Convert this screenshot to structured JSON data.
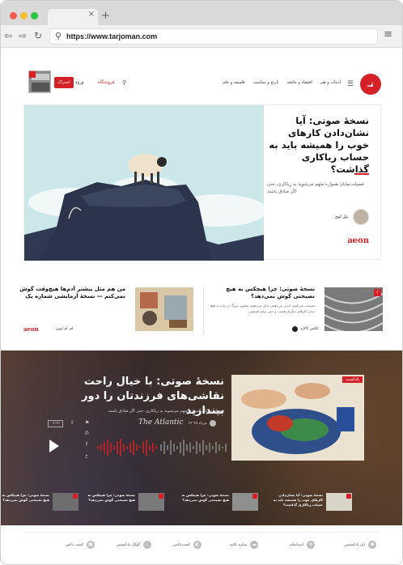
{
  "browser": {
    "url": "https://www.tarjoman.com",
    "tab_close": "×",
    "tab_plus": "+",
    "icons": [
      "back-icon",
      "forward-icon",
      "reload-icon",
      "search-icon",
      "menu-icon"
    ]
  },
  "header": {
    "logo_text": "تـ",
    "nav": [
      "ادبیات و هنر",
      "اقتصاد و جامعه",
      "تاریخ و سیاست",
      "فلسفه و علم"
    ],
    "shop": "فروشگاه",
    "login": "ورود",
    "subscribe": "اشتراک"
  },
  "hero": {
    "title": "نسخۀ صوتی: آیا نشان‌دادن کارهای خوب را همیشه باید به حساب ریاکاری گذاشت؟",
    "description": "فضیلت‌نمایان همواره متهم می‌شوند به ریاکاری، حتی اگر صادق باشند",
    "author": "نیل لوی",
    "brand": "aeon"
  },
  "cards": [
    {
      "title": "نسخۀ صوتی: چرا هیچکس به هیچ نصیحتی گوش نمی‌دهد؟",
      "description": "نصیحت می‌کنیم، اندرز می‌دهیم، تذکر می‌دهیم، تفاوتی بزرگ در باره به هیچ دیدن کارهای دیگران هست و حتی برای قسمتی",
      "author": "الکس کالارد"
    },
    {
      "title": "من هم مثل بیشتر آدم‌ها هیچ‌وقت گوش نمی‌کنم — نسخۀ آزمایشی شماره یک",
      "author": "ام. ام اوون",
      "brand": "aeon"
    }
  ],
  "podcast": {
    "badge": "پادکست",
    "title": "نسخۀ صوتی: با خیال راحت نقاشی‌های فرزندتان را دور بیندازید",
    "description": "فضیلت‌نمایان همواره متهم می‌شوند به ریاکاری، حتی اگر صادق باشند",
    "brand": "The Atlantic",
    "date": "۲۳ مرداد ۹۹",
    "time": "۰۴:۳۶",
    "share_icons": [
      "share-icon",
      "bookmark-icon"
    ],
    "social": [
      "instagram-icon",
      "facebook-icon",
      "twitter-icon"
    ],
    "mini": [
      "نسخۀ صوتی: چرا هیچکس به هیچ نصیحتی گوش نمی‌دهد؟",
      "نسخۀ صوتی: چرا هیچکس به هیچ نصیحتی گوش نمی‌دهد؟",
      "نسخۀ صوتی: چرا هیچکس به هیچ نصیحتی گوش نمی‌دهد؟",
      "نسخۀ صوتی: آیا نشان‌دادن کارهای خوب را همیشه باید به حساب ریاکاری گذاشت؟"
    ]
  },
  "platforms": [
    "اپل پادکستس",
    "اسپاتیفای",
    "ساوند کلاود",
    "کست‌باکس",
    "گوگل پادکستس",
    "کست باکس"
  ]
}
